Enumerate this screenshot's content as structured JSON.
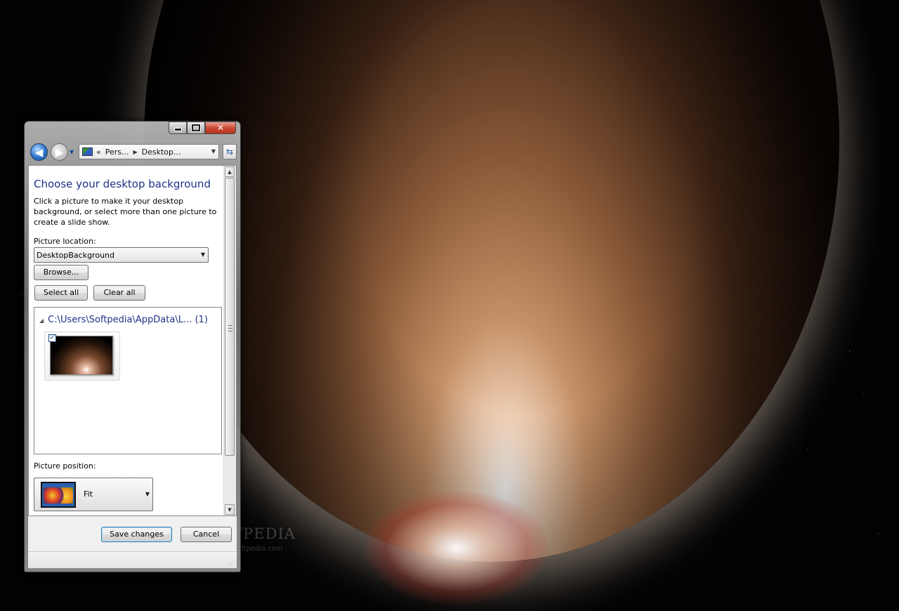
{
  "window": {
    "address_parts": [
      "«",
      "Pers...",
      "Desktop..."
    ],
    "min_glyph": "",
    "close_glyph": "✕"
  },
  "page": {
    "heading": "Choose your desktop background",
    "description": "Click a picture to make it your desktop background, or select more than one picture to create a slide show.",
    "picture_location_label": "Picture location:",
    "picture_location_value": "DesktopBackground",
    "browse_label": "Browse...",
    "select_all_label": "Select all",
    "clear_all_label": "Clear all",
    "group_header": "C:\\Users\\Softpedia\\AppData\\L... (1)",
    "thumbnail_checked": "✓",
    "picture_position_label": "Picture position:",
    "picture_position_value": "Fit"
  },
  "footer": {
    "save_label": "Save changes",
    "cancel_label": "Cancel"
  },
  "desktop": {
    "watermark": "SOFTPEDIA",
    "watermark_sub": "www.softpedia.com"
  },
  "icons": {
    "back": "◀",
    "forward": "▶",
    "dropdown": "▼",
    "refresh": "⇆",
    "collapse": "◢",
    "scroll_up": "▲",
    "scroll_down": "▼"
  },
  "colors": {
    "heading": "#1e3287",
    "accent": "#2b74c9",
    "close_button": "#c8452e"
  }
}
